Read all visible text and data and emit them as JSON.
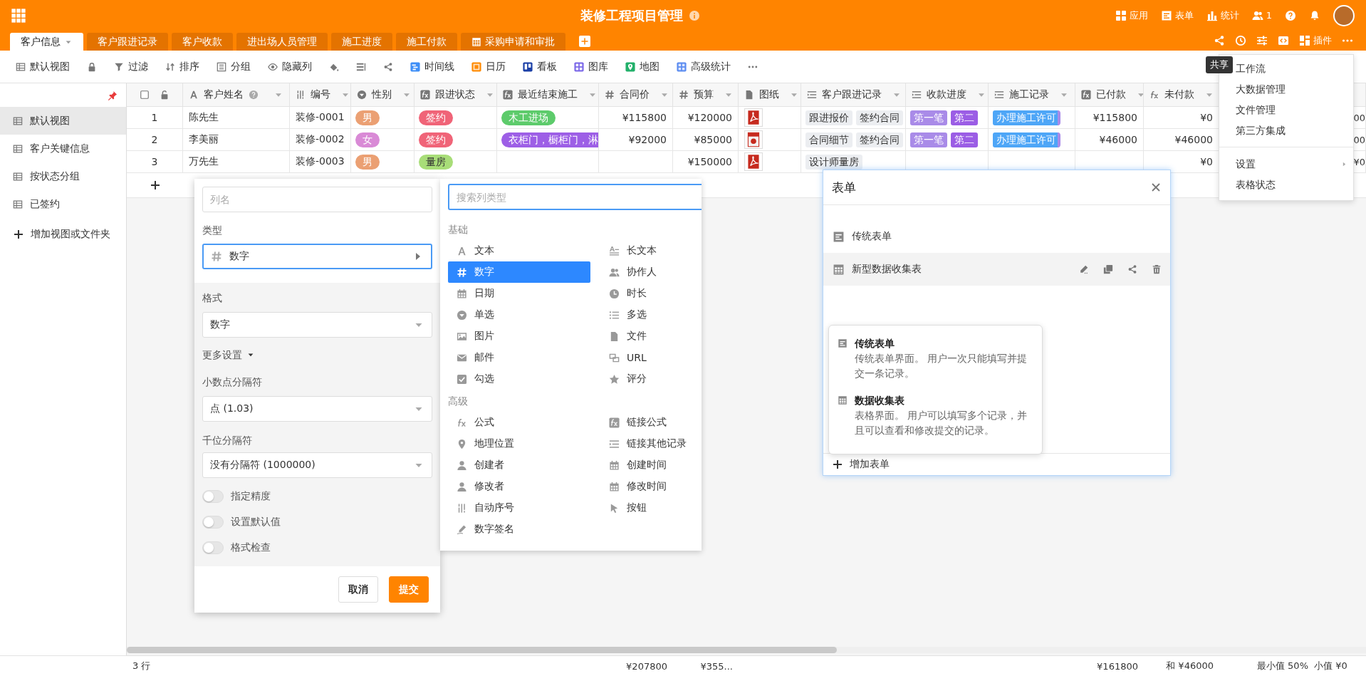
{
  "app": {
    "title": "装修工程项目管理"
  },
  "header_actions": [
    {
      "kind": "apps",
      "label": "应用"
    },
    {
      "kind": "form",
      "label": "表单"
    },
    {
      "kind": "stats",
      "label": "统计"
    },
    {
      "kind": "users",
      "label": "1"
    },
    {
      "kind": "help"
    },
    {
      "kind": "bell"
    },
    {
      "kind": "avatar"
    }
  ],
  "tabs": [
    {
      "label": "客户信息",
      "kind": "table",
      "selected": true
    },
    {
      "label": "客户跟进记录",
      "kind": "table",
      "selected": false
    },
    {
      "label": "客户收款",
      "kind": "table",
      "selected": false
    },
    {
      "label": "进出场人员管理",
      "kind": "table",
      "selected": false
    },
    {
      "label": "施工进度",
      "kind": "table",
      "selected": false
    },
    {
      "label": "施工付款",
      "kind": "table",
      "selected": false
    },
    {
      "label": "采购申请和审批",
      "kind": "external",
      "selected": false
    }
  ],
  "tab_tools": [
    {
      "kind": "share"
    },
    {
      "kind": "history"
    },
    {
      "kind": "settings"
    },
    {
      "kind": "code"
    },
    {
      "kind": "plugin",
      "label": "插件"
    },
    {
      "kind": "more"
    }
  ],
  "tooltip": "共享",
  "toolbar": [
    {
      "kind": "view",
      "label": "默认视图"
    },
    {
      "kind": "lock"
    },
    {
      "kind": "filter",
      "label": "过滤"
    },
    {
      "kind": "sort",
      "label": "排序"
    },
    {
      "kind": "group",
      "label": "分组"
    },
    {
      "kind": "hide",
      "label": "隐藏列"
    },
    {
      "kind": "fill"
    },
    {
      "kind": "row_height"
    },
    {
      "kind": "share"
    },
    {
      "kind": "timeline",
      "label": "时间线"
    },
    {
      "kind": "calendar",
      "label": "日历"
    },
    {
      "kind": "kanban",
      "label": "看板"
    },
    {
      "kind": "gallery",
      "label": "图库"
    },
    {
      "kind": "map",
      "label": "地图"
    },
    {
      "kind": "stats",
      "label": "高级统计"
    },
    {
      "kind": "more"
    }
  ],
  "sidebar": {
    "items": [
      {
        "label": "默认视图",
        "selected": true
      },
      {
        "label": "客户关键信息",
        "selected": false
      },
      {
        "label": "按状态分组",
        "selected": false
      },
      {
        "label": "已签约",
        "selected": false
      }
    ],
    "add": "增加视图或文件夹"
  },
  "table": {
    "columns": [
      {
        "label": "客户姓名",
        "kind": "text",
        "tip": true
      },
      {
        "label": "编号",
        "kind": "autonumber",
        "tip": false
      },
      {
        "label": "性别",
        "kind": "select",
        "tip": false
      },
      {
        "label": "跟进状态",
        "kind": "linkformula",
        "tip": false
      },
      {
        "label": "最近结束施工",
        "kind": "linkformula",
        "tip": false
      },
      {
        "label": "合同价",
        "kind": "number",
        "tip": false
      },
      {
        "label": "预算",
        "kind": "number",
        "tip": false
      },
      {
        "label": "图纸",
        "kind": "file",
        "tip": false
      },
      {
        "label": "客户跟进记录",
        "kind": "link",
        "tip": false
      },
      {
        "label": "收款进度",
        "kind": "link",
        "tip": false
      },
      {
        "label": "施工记录",
        "kind": "link",
        "tip": false
      },
      {
        "label": "已付款",
        "kind": "linkformula",
        "tip": false
      },
      {
        "label": "未付款",
        "kind": "formula",
        "tip": false
      }
    ],
    "rows": [
      {
        "number": "1",
        "cells": [
          {
            "kind": "text",
            "text": "陈先生"
          },
          {
            "kind": "text",
            "text": "装修-0001"
          },
          {
            "kind": "chips",
            "chips": [
              {
                "label": "男",
                "color": "#eba073"
              }
            ]
          },
          {
            "kind": "chips",
            "chips": [
              {
                "label": "签约",
                "color": "#f06478"
              }
            ]
          },
          {
            "kind": "chips",
            "chips": [
              {
                "label": "木工进场",
                "color": "#5dcb6b"
              }
            ]
          },
          {
            "kind": "text",
            "text": "¥115800"
          },
          {
            "kind": "text",
            "text": "¥120000"
          },
          {
            "kind": "pdf"
          },
          {
            "kind": "chips",
            "chips": [
              {
                "label": "跟进报价",
                "color": "#eceef1"
              },
              {
                "label": "签约合同",
                "color": "#eceef1"
              }
            ]
          },
          {
            "kind": "chips",
            "chips": [
              {
                "label": "第一笔",
                "color": "#a98be8"
              },
              {
                "label": "第二",
                "color": "#9b5de5"
              }
            ]
          },
          {
            "kind": "chips",
            "chips": [
              {
                "label": "办理施工许可",
                "color": "#4ea6f7"
              },
              {
                "color": "#a98be8"
              }
            ]
          },
          {
            "kind": "text",
            "text": "¥115800"
          },
          {
            "kind": "text",
            "text": "¥0"
          },
          {
            "kind": "text",
            "text": "00"
          }
        ]
      },
      {
        "number": "2",
        "cells": [
          {
            "kind": "text",
            "text": "李美丽"
          },
          {
            "kind": "text",
            "text": "装修-0002"
          },
          {
            "kind": "chips",
            "chips": [
              {
                "label": "女",
                "color": "#d98ad6"
              }
            ]
          },
          {
            "kind": "chips",
            "chips": [
              {
                "label": "签约",
                "color": "#f06478"
              }
            ]
          },
          {
            "kind": "chips",
            "chips": [
              {
                "label": "衣柜门，橱柜门，淋",
                "color": "#9d5fe6"
              }
            ]
          },
          {
            "kind": "text",
            "text": "¥92000"
          },
          {
            "kind": "text",
            "text": "¥85000"
          },
          {
            "kind": "ppt"
          },
          {
            "kind": "chips",
            "chips": [
              {
                "label": "合同细节",
                "color": "#eceef1"
              },
              {
                "label": "签约合同",
                "color": "#eceef1"
              }
            ]
          },
          {
            "kind": "chips",
            "chips": [
              {
                "label": "第一笔",
                "color": "#a98be8"
              },
              {
                "label": "第二",
                "color": "#9b5de5"
              }
            ]
          },
          {
            "kind": "chips",
            "chips": [
              {
                "label": "办理施工许可",
                "color": "#4ea6f7"
              },
              {
                "color": "#a98be8"
              }
            ]
          },
          {
            "kind": "text",
            "text": "¥46000"
          },
          {
            "kind": "text",
            "text": "¥46000"
          },
          {
            "kind": "text",
            "text": "00"
          }
        ]
      },
      {
        "number": "3",
        "cells": [
          {
            "kind": "text",
            "text": "万先生"
          },
          {
            "kind": "text",
            "text": "装修-0003"
          },
          {
            "kind": "chips",
            "chips": [
              {
                "label": "男",
                "color": "#eba073"
              }
            ]
          },
          {
            "kind": "chips",
            "chips": [
              {
                "label": "量房",
                "color": "#a8dd78"
              }
            ]
          },
          {
            "kind": "empty"
          },
          {
            "kind": "empty"
          },
          {
            "kind": "text",
            "text": "¥150000"
          },
          {
            "kind": "pdf"
          },
          {
            "kind": "chips",
            "chips": [
              {
                "label": "设计师量房",
                "color": "#eceef1"
              }
            ]
          },
          {
            "kind": "empty"
          },
          {
            "kind": "empty"
          },
          {
            "kind": "empty"
          },
          {
            "kind": "text",
            "text": "¥0"
          },
          {
            "kind": "text",
            "text": "¥0"
          }
        ]
      }
    ]
  },
  "status_bar": {
    "row_count": "3 行",
    "summaries": [
      "¥207800",
      "¥355...",
      "¥161800",
      "和 ¥46000",
      "最小值 50%",
      "小值 ¥0"
    ]
  },
  "column_dialog": {
    "name_placeholder": "列名",
    "type_label": "类型",
    "type_value": {
      "kind": "number",
      "label": "数字"
    },
    "format_label": "格式",
    "format_value": "数字",
    "more_settings": "更多设置",
    "decimal_label": "小数点分隔符",
    "decimal_value": "点 (1.03)",
    "thousands_label": "千位分隔符",
    "thousands_value": "没有分隔符 (1000000)",
    "toggles": [
      {
        "label": "指定精度",
        "on": false
      },
      {
        "label": "设置默认值",
        "on": false
      },
      {
        "label": "格式检查",
        "on": false
      }
    ],
    "cancel": "取消",
    "submit": "提交"
  },
  "type_picker": {
    "search_placeholder": "搜索列类型",
    "groups": [
      {
        "label": "基础",
        "items": [
          {
            "label": "文本",
            "kind": "text",
            "selected": false
          },
          {
            "label": "长文本",
            "kind": "longtext",
            "selected": false
          },
          {
            "label": "数字",
            "kind": "number",
            "selected": true
          },
          {
            "label": "协作人",
            "kind": "collaborator",
            "selected": false
          },
          {
            "label": "日期",
            "kind": "date",
            "selected": false
          },
          {
            "label": "时长",
            "kind": "duration",
            "selected": false
          },
          {
            "label": "单选",
            "kind": "select",
            "selected": false
          },
          {
            "label": "多选",
            "kind": "multiselect",
            "selected": false
          },
          {
            "label": "图片",
            "kind": "image",
            "selected": false
          },
          {
            "label": "文件",
            "kind": "file",
            "selected": false
          },
          {
            "label": "邮件",
            "kind": "email",
            "selected": false
          },
          {
            "label": "URL",
            "kind": "url",
            "selected": false
          },
          {
            "label": "勾选",
            "kind": "checkbox",
            "selected": false
          },
          {
            "label": "评分",
            "kind": "rating",
            "selected": false
          }
        ]
      },
      {
        "label": "高级",
        "items": [
          {
            "label": "公式",
            "kind": "formula",
            "selected": false
          },
          {
            "label": "链接公式",
            "kind": "linkformula",
            "selected": false
          },
          {
            "label": "地理位置",
            "kind": "geolocation",
            "selected": false
          },
          {
            "label": "链接其他记录",
            "kind": "link",
            "selected": false
          },
          {
            "label": "创建者",
            "kind": "creator",
            "selected": false
          },
          {
            "label": "创建时间",
            "kind": "ctime",
            "selected": false
          },
          {
            "label": "修改者",
            "kind": "modifier",
            "selected": false
          },
          {
            "label": "修改时间",
            "kind": "mtime",
            "selected": false
          },
          {
            "label": "自动序号",
            "kind": "autonumber",
            "selected": false
          },
          {
            "label": "按钮",
            "kind": "button",
            "selected": false
          },
          {
            "label": "数字签名",
            "kind": "signature",
            "selected": false
          }
        ]
      }
    ]
  },
  "forms_panel": {
    "title": "表单",
    "forms": [
      {
        "label": "传统表单",
        "kind": "classic",
        "selected": false
      },
      {
        "label": "新型数据收集表",
        "kind": "collect",
        "selected": true
      }
    ],
    "options": [
      {
        "kind": "classic",
        "title": "传统表单",
        "description": "传统表单界面。 用户一次只能填写并提交一条记录。"
      },
      {
        "kind": "collect",
        "title": "数据收集表",
        "description": "表格界面。 用户可以填写多个记录，并且可以查看和修改提交的记录。"
      }
    ],
    "add": "增加表单"
  },
  "menu": {
    "groups": [
      [
        {
          "label": "工作流",
          "submenu": false
        },
        {
          "label": "大数据管理",
          "submenu": false
        },
        {
          "label": "文件管理",
          "submenu": false
        },
        {
          "label": "第三方集成",
          "submenu": false
        }
      ],
      [
        {
          "label": "设置",
          "submenu": true
        },
        {
          "label": "表格状态",
          "submenu": false
        }
      ]
    ]
  }
}
